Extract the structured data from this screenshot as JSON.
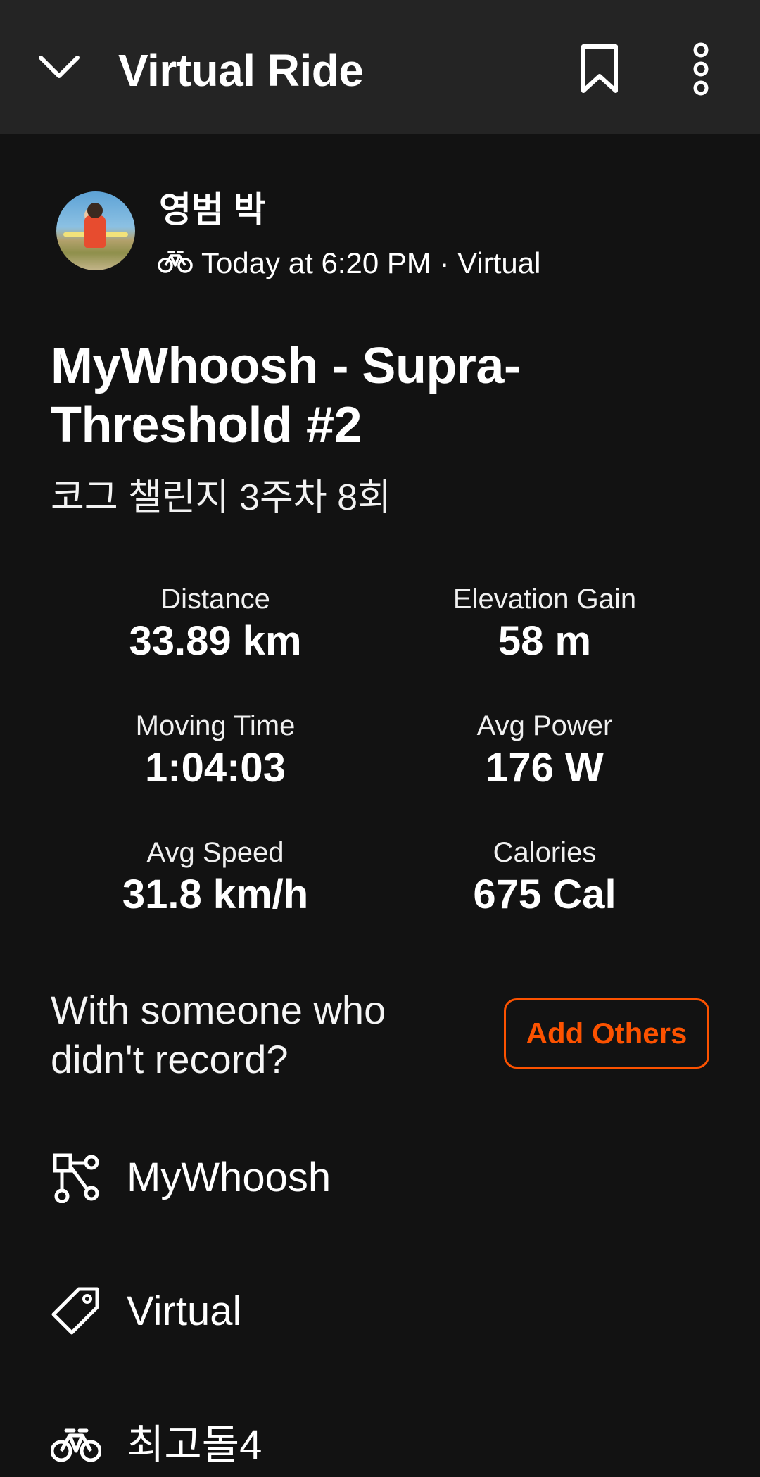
{
  "header": {
    "title": "Virtual Ride",
    "back_icon": "chevron-down-icon",
    "bookmark_icon": "bookmark-icon",
    "more_icon": "more-vertical-icon"
  },
  "athlete": {
    "name": "영범 박",
    "activity_icon": "bike-icon",
    "meta": "Today at 6:20 PM · Virtual"
  },
  "activity": {
    "title": "MyWhoosh - Supra-Threshold #2",
    "description": "코그 챌린지 3주차 8회"
  },
  "stats": [
    {
      "label": "Distance",
      "value": "33.89 km"
    },
    {
      "label": "Elevation Gain",
      "value": "58 m"
    },
    {
      "label": "Moving Time",
      "value": "1:04:03"
    },
    {
      "label": "Avg Power",
      "value": "176 W"
    },
    {
      "label": "Avg Speed",
      "value": "31.8 km/h"
    },
    {
      "label": "Calories",
      "value": "675 Cal"
    }
  ],
  "with_others": {
    "prompt": "With someone who didn't record?",
    "button_label": "Add Others"
  },
  "details": [
    {
      "icon": "route-icon",
      "label": "MyWhoosh"
    },
    {
      "icon": "tag-icon",
      "label": "Virtual"
    },
    {
      "icon": "bike-icon",
      "label": "최고돌4"
    }
  ],
  "colors": {
    "accent": "#fc5200",
    "background": "#121212",
    "header_background": "#242424"
  }
}
